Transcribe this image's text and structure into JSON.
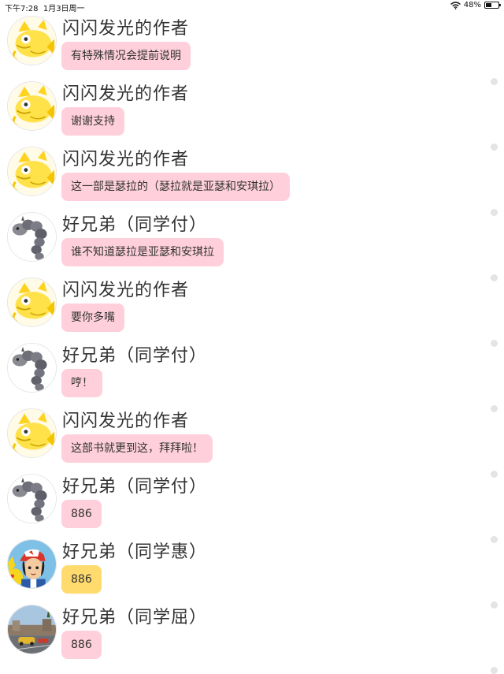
{
  "status_bar": {
    "time": "下午7:28",
    "date": "1月3日周一",
    "battery": "48%",
    "battery_level": 0.48,
    "icons": [
      "wifi-icon",
      "battery-icon"
    ]
  },
  "messages": [
    {
      "sender": "闪闪发光的作者",
      "avatar": "magikarp",
      "text": "有特殊情况会提前说明",
      "bubble_color": "#ffd0dc"
    },
    {
      "sender": "闪闪发光的作者",
      "avatar": "magikarp",
      "text": "谢谢支持",
      "bubble_color": "#ffd0dc"
    },
    {
      "sender": "闪闪发光的作者",
      "avatar": "magikarp",
      "text": "这一部是瑟拉的（瑟拉就是亚瑟和安琪拉）",
      "bubble_color": "#ffd0dc"
    },
    {
      "sender": "好兄弟（同学付）",
      "avatar": "onix",
      "text": "谁不知道瑟拉是亚瑟和安琪拉",
      "bubble_color": "#ffd0dc"
    },
    {
      "sender": "闪闪发光的作者",
      "avatar": "magikarp",
      "text": "要你多嘴",
      "bubble_color": "#ffd0dc"
    },
    {
      "sender": "好兄弟（同学付）",
      "avatar": "onix",
      "text": "哼！",
      "bubble_color": "#ffd0dc"
    },
    {
      "sender": "闪闪发光的作者",
      "avatar": "magikarp",
      "text": "这部书就更到这，拜拜啦！",
      "bubble_color": "#ffd0dc"
    },
    {
      "sender": "好兄弟（同学付）",
      "avatar": "onix",
      "text": "886",
      "bubble_color": "#ffd0dc"
    },
    {
      "sender": "好兄弟（同学惠）",
      "avatar": "ash-pikachu",
      "text": "886",
      "bubble_color": "#ffdb6e"
    },
    {
      "sender": "好兄弟（同学屈）",
      "avatar": "street-photo",
      "text": "886",
      "bubble_color": "#ffd0dc"
    }
  ]
}
